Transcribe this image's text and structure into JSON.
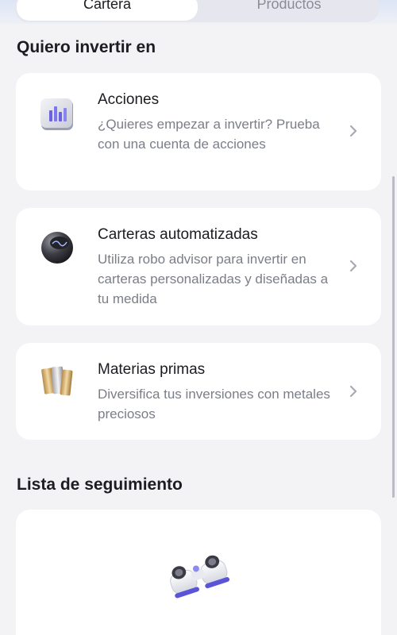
{
  "tabs": [
    {
      "label": "Cartera",
      "active": true
    },
    {
      "label": "Productos",
      "active": false
    }
  ],
  "invest_section": {
    "title": "Quiero invertir en",
    "cards": [
      {
        "title": "Acciones",
        "description": "¿Quieres empezar a invertir? Prueba con una cuenta de acciones",
        "icon": "bar-chart-icon"
      },
      {
        "title": "Carteras automatizadas",
        "description": "Utiliza robo advisor para invertir en carteras personalizadas y diseñadas a tu medida",
        "icon": "robo-sphere-icon"
      },
      {
        "title": "Materias primas",
        "description": "Diversifica tus inversiones con metales preciosos",
        "icon": "metal-bars-icon"
      }
    ]
  },
  "watchlist_section": {
    "title": "Lista de seguimiento",
    "icon": "binoculars-icon"
  },
  "colors": {
    "accent": "#6b62e0",
    "card_bg": "#ffffff",
    "page_bg": "#f3f3f6",
    "muted_text": "#7b7e88"
  }
}
